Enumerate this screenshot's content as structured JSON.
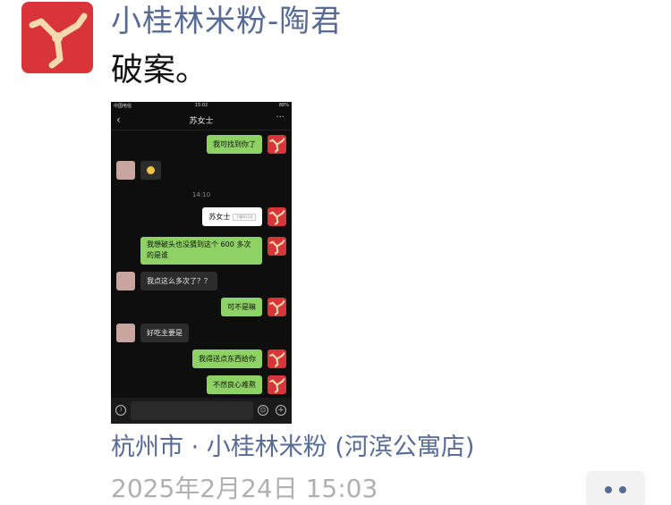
{
  "post": {
    "author": "小桂林米粉-陶君",
    "text": "破案。",
    "location": "杭州市 · 小桂林米粉 (河滨公寓店)",
    "timestamp": "2025年2月24日 15:03",
    "avatar_icon": "triskelion-icon",
    "avatar_color": "#d8343a",
    "link_color": "#586b95"
  },
  "screenshot": {
    "status": {
      "carrier": "中国电信",
      "time": "15:02",
      "battery": "88%"
    },
    "chat_title": "苏女士",
    "messages": [
      {
        "side": "right",
        "text": "我可找到你了"
      },
      {
        "side": "left",
        "text": ""
      },
      {
        "side": "center",
        "text": "14:10"
      },
      {
        "side": "right",
        "text": "苏女士",
        "tag": "下题815次"
      },
      {
        "side": "right",
        "text": "我想破头也没猜到这个 600 多次的是谁"
      },
      {
        "side": "left",
        "text": "我点这么多次了？？"
      },
      {
        "side": "right",
        "text": "可不是嘛"
      },
      {
        "side": "left",
        "text": "好吃主要是"
      },
      {
        "side": "right",
        "text": "我得送点东西给你"
      },
      {
        "side": "right",
        "text": "不然良心难熬"
      }
    ]
  }
}
